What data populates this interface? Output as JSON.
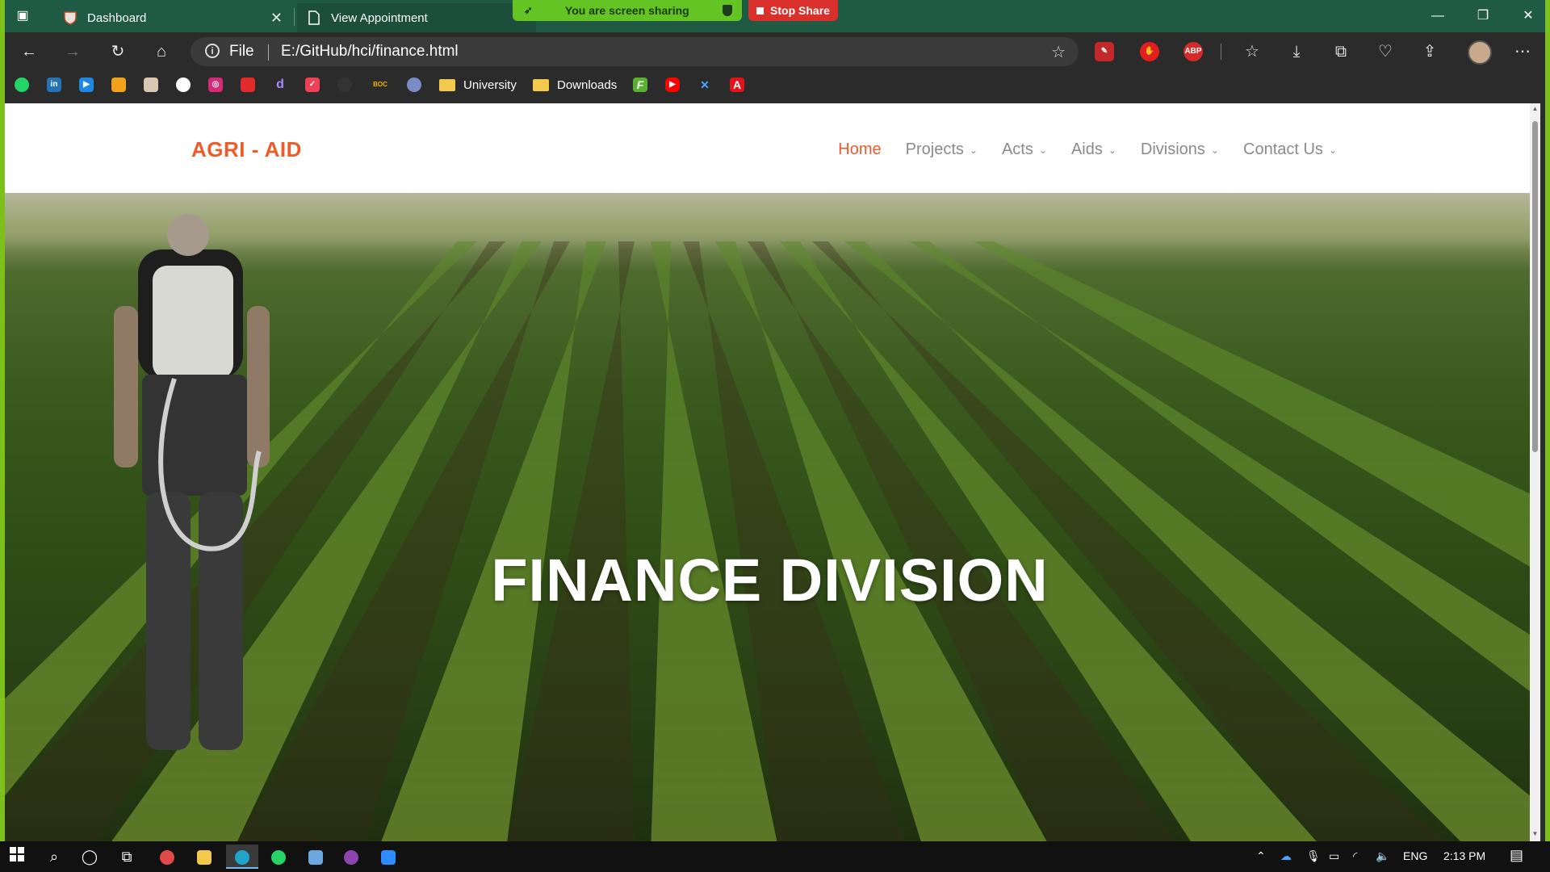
{
  "browser": {
    "tabs": [
      {
        "label": "Dashboard",
        "active": false
      },
      {
        "label": "View Appointment",
        "active": true
      }
    ],
    "screen_share": {
      "status": "You are screen sharing",
      "stop_label": "Stop Share"
    },
    "window_controls": {
      "minimize": "—",
      "restore": "❐",
      "close": "✕"
    },
    "address": {
      "scheme": "File",
      "url": "E:/GitHub/hci/finance.html"
    },
    "extensions": [
      {
        "icon": "pen-extension-icon",
        "text": "",
        "color": "#d9302c"
      },
      {
        "icon": "hand-extension-icon",
        "text": "",
        "color": "#e0201f"
      },
      {
        "icon": "adblock-plus-icon",
        "text": "ABP",
        "color": "#d42a2a"
      }
    ],
    "bookmarks": [
      {
        "icon": "whatsapp-icon",
        "label": "",
        "color": "#25d366"
      },
      {
        "icon": "linkedin-icon",
        "label": "in",
        "color": "#2474b5"
      },
      {
        "icon": "video-icon",
        "label": "",
        "color": "#1e88e5"
      },
      {
        "icon": "team-icon",
        "label": "",
        "color": "#f0a21b"
      },
      {
        "icon": "crest-icon",
        "label": "",
        "color": "#d7c7b3"
      },
      {
        "icon": "github-icon",
        "label": "",
        "color": "#ffffff"
      },
      {
        "icon": "instagram-icon",
        "label": "",
        "color": "#d62976"
      },
      {
        "icon": "huawei-icon",
        "label": "",
        "color": "#e12a2a"
      },
      {
        "icon": "dev-icon",
        "label": "d",
        "color": "#6a5acd"
      },
      {
        "icon": "pocket-icon",
        "label": "",
        "color": "#ef4056"
      },
      {
        "icon": "circle-icon",
        "label": "",
        "color": "#333333"
      },
      {
        "icon": "boc-icon",
        "label": "BOC",
        "color": "#f3b400"
      },
      {
        "icon": "emblem-icon",
        "label": "",
        "color": "#7a8cc8"
      },
      {
        "icon": "folder-icon",
        "label": "University",
        "color": "#f2c94c"
      },
      {
        "icon": "folder-icon",
        "label": "Downloads",
        "color": "#f2c94c"
      },
      {
        "icon": "f-icon",
        "label": "F",
        "color": "#5ab030"
      },
      {
        "icon": "youtube-icon",
        "label": "",
        "color": "#ff0000"
      },
      {
        "icon": "x-icon",
        "label": "✕",
        "color": "#1f5fbf"
      },
      {
        "icon": "adobe-icon",
        "label": "A",
        "color": "#e3121b"
      }
    ]
  },
  "site": {
    "brand": "AGRI - AID",
    "nav": [
      {
        "label": "Home",
        "active": true,
        "dropdown": false
      },
      {
        "label": "Projects",
        "active": false,
        "dropdown": true
      },
      {
        "label": "Acts",
        "active": false,
        "dropdown": true
      },
      {
        "label": "Aids",
        "active": false,
        "dropdown": true
      },
      {
        "label": "Divisions",
        "active": false,
        "dropdown": true
      },
      {
        "label": "Contact Us",
        "active": false,
        "dropdown": true
      }
    ],
    "hero_title": "FINANCE DIVISION",
    "accent_color": "#ee5b2b"
  },
  "taskbar": {
    "language": "ENG",
    "time": "2:13 PM"
  }
}
